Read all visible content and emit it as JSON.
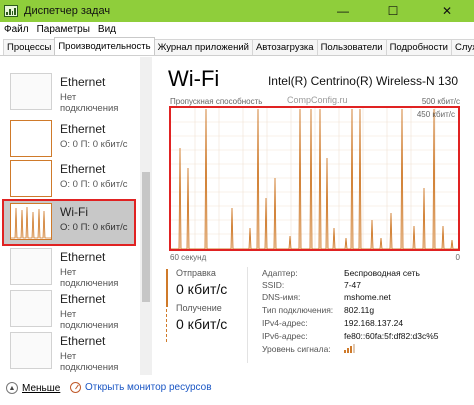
{
  "window": {
    "title": "Диспетчер задач",
    "minimize_glyph": "—",
    "maximize_glyph": "☐",
    "close_glyph": "✕"
  },
  "menu": [
    "Файл",
    "Параметры",
    "Вид"
  ],
  "tabs": [
    "Процессы",
    "Производительность",
    "Журнал приложений",
    "Автозагрузка",
    "Пользователи",
    "Подробности",
    "Службы"
  ],
  "active_tab": "Производительность",
  "devices": [
    {
      "name": "Ethernet",
      "status": "Нет подключения",
      "thumb": "empty"
    },
    {
      "name": "Ethernet",
      "status": "О: 0 П: 0 кбит/с",
      "thumb": "orange"
    },
    {
      "name": "Ethernet",
      "status": "О: 0 П: 0 кбит/с",
      "thumb": "orange"
    },
    {
      "name": "Wi-Fi",
      "status": "О: 0 П: 0 кбит/с",
      "thumb": "wifi",
      "selected": true
    },
    {
      "name": "Ethernet",
      "status": "Нет подключения",
      "thumb": "empty"
    },
    {
      "name": "Ethernet",
      "status": "Нет подключения",
      "thumb": "empty"
    },
    {
      "name": "Ethernet",
      "status": "Нет подключения",
      "thumb": "empty"
    }
  ],
  "detail": {
    "title": "Wi-Fi",
    "adapter": "Intel(R) Centrino(R) Wireless-N 130",
    "watermark": "CompConfig.ru",
    "graph_label": "Пропускная способность",
    "graph_max": "500 кбит/с",
    "graph_scale_inner": "450 кбит/с",
    "graph_time": "60 секунд",
    "graph_min": "0",
    "send_label": "Отправка",
    "send_value": "0 кбит/с",
    "recv_label": "Получение",
    "recv_value": "0 кбит/с",
    "properties": [
      {
        "key": "Адаптер:",
        "value": "Беспроводная сеть"
      },
      {
        "key": "SSID:",
        "value": "7-47"
      },
      {
        "key": "DNS-имя:",
        "value": "mshome.net"
      },
      {
        "key": "Тип подключения:",
        "value": "802.11g"
      },
      {
        "key": "IPv4-адрес:",
        "value": "192.168.137.24"
      },
      {
        "key": "IPv6-адрес:",
        "value": "fe80::60fa:5f:df82:d3c%5"
      },
      {
        "key": "Уровень сигнала:",
        "value": ""
      }
    ],
    "signal_level": 3,
    "signal_max": 4
  },
  "footer": {
    "less": "Меньше",
    "monitor": "Открыть монитор ресурсов"
  },
  "colors": {
    "titlebar": "#8fce3b",
    "accent_orange": "#cf7a2a",
    "highlight_red": "#e02222",
    "link_blue": "#1a56c4"
  }
}
